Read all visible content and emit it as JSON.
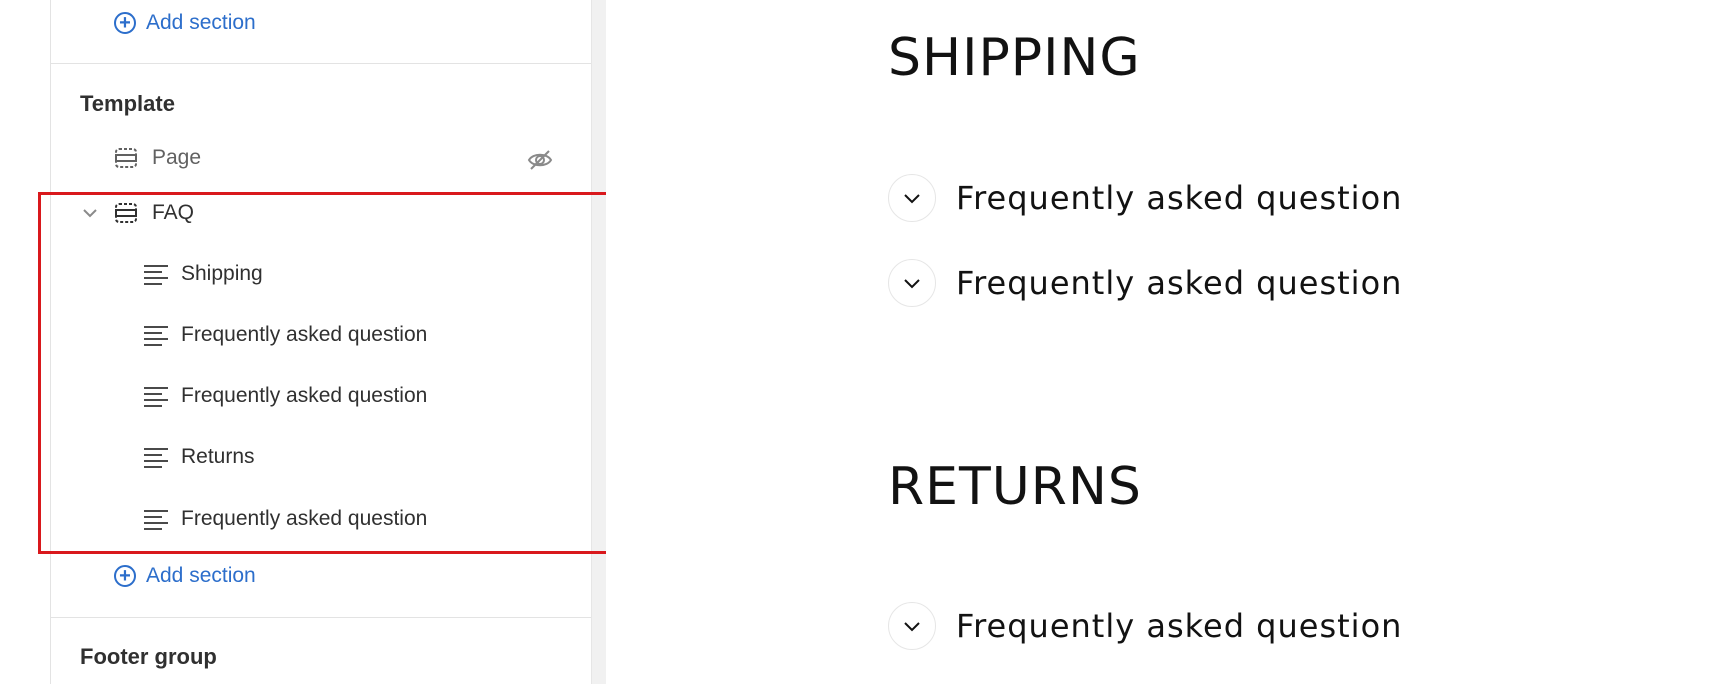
{
  "sidebar": {
    "top_add_section": "Add section",
    "template": {
      "title": "Template",
      "items": [
        {
          "label": "Page",
          "type": "section",
          "hidden": true
        },
        {
          "label": "FAQ",
          "type": "section",
          "expanded": true
        }
      ],
      "faq_blocks": [
        {
          "label": "Shipping"
        },
        {
          "label": "Frequently asked question"
        },
        {
          "label": "Frequently asked question"
        },
        {
          "label": "Returns"
        },
        {
          "label": "Frequently asked question"
        }
      ],
      "add_section": "Add section"
    },
    "footer_group": {
      "title": "Footer group"
    }
  },
  "preview": {
    "shipping_heading": "SHIPPING",
    "shipping_questions": [
      "Frequently asked question",
      "Frequently asked question"
    ],
    "returns_heading": "RETURNS",
    "returns_questions": [
      "Frequently asked question"
    ]
  },
  "colors": {
    "accent": "#2c6ecb",
    "highlight": "#d9181c",
    "text": "#303030"
  },
  "icons": {
    "add": "plus-circle-icon",
    "section": "section-icon",
    "block": "text-block-icon",
    "hide": "eye-slash-icon",
    "chevron": "chevron-down-icon"
  }
}
